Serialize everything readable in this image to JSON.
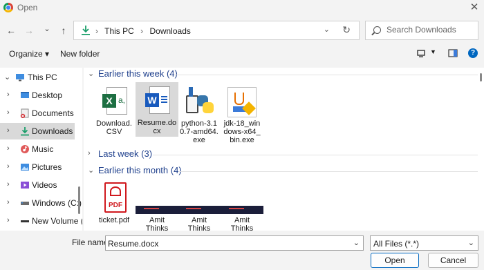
{
  "window": {
    "title": "Open",
    "close_glyph": "✕"
  },
  "nav": {
    "back_glyph": "←",
    "forward_glyph": "→",
    "recent_glyph": "⌄",
    "up_glyph": "↑",
    "breadcrumb": [
      "This PC",
      "Downloads"
    ],
    "sep_glyph": "›",
    "refresh_glyph": "↻",
    "search_placeholder": "Search Downloads"
  },
  "toolbar": {
    "organize_label": "Organize ▾",
    "new_folder_label": "New folder",
    "help_glyph": "?"
  },
  "sidebar": {
    "items": [
      {
        "label": "This PC",
        "chevron": "⌄",
        "icon": "computer-icon"
      },
      {
        "label": "Desktop",
        "chevron": "›",
        "icon": "desktop-folder-icon"
      },
      {
        "label": "Documents",
        "chevron": "›",
        "icon": "documents-folder-icon"
      },
      {
        "label": "Downloads",
        "chevron": "›",
        "icon": "downloads-folder-icon",
        "selected": true
      },
      {
        "label": "Music",
        "chevron": "›",
        "icon": "music-folder-icon"
      },
      {
        "label": "Pictures",
        "chevron": "›",
        "icon": "pictures-folder-icon"
      },
      {
        "label": "Videos",
        "chevron": "›",
        "icon": "videos-folder-icon"
      },
      {
        "label": "Windows (C:)",
        "chevron": "›",
        "icon": "drive-icon"
      },
      {
        "label": "New Volume (",
        "chevron": "›",
        "icon": "drive-icon"
      }
    ]
  },
  "groups": [
    {
      "title": "Earlier this week (4)",
      "chevron": "⌄",
      "expanded": true
    },
    {
      "title": "Last week (3)",
      "chevron": "›",
      "expanded": false
    },
    {
      "title": "Earlier this month (4)",
      "chevron": "⌄",
      "expanded": true
    }
  ],
  "files_week": [
    {
      "name": "Download.\nCSV",
      "icon": "excel-icon"
    },
    {
      "name": "Resume.do\ncx",
      "icon": "word-icon",
      "selected": true
    },
    {
      "name": "python-3.1\n0.7-amd64.\nexe",
      "icon": "python-installer-icon"
    },
    {
      "name": "jdk-18_win\ndows-x64_\nbin.exe",
      "icon": "java-installer-icon"
    }
  ],
  "files_month": [
    {
      "name": "ticket.pdf",
      "icon": "pdf-icon"
    },
    {
      "name": "Amit\nThinks",
      "icon": "image-thumbnail-icon"
    },
    {
      "name": "Amit\nThinks",
      "icon": "image-thumbnail-icon"
    },
    {
      "name": "Amit\nThinks",
      "icon": "image-thumbnail-icon"
    }
  ],
  "pdf_icon_text": "PDF",
  "excel_letter": "X",
  "word_letter": "W",
  "bottom": {
    "file_name_label": "File name:",
    "file_name_value": "Resume.docx",
    "file_type_value": "All Files (*.*)",
    "open_label": "Open",
    "cancel_label": "Cancel",
    "dropdown_glyph": "⌄"
  },
  "colors": {
    "accent": "#0067c0",
    "group_title": "#1e3f8c",
    "selection": "#d9d9d9"
  }
}
